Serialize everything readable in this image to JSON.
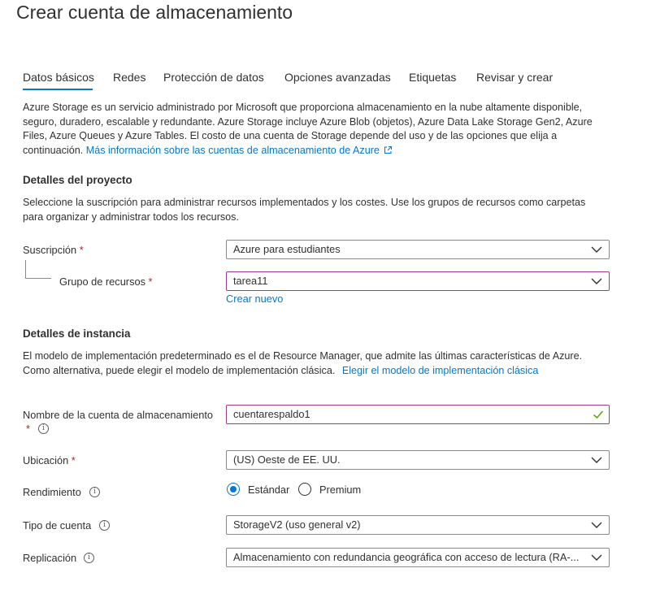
{
  "page": {
    "title": "Crear cuenta de almacenamiento"
  },
  "tabs": [
    {
      "label": "Datos básicos",
      "active": true
    },
    {
      "label": "Redes"
    },
    {
      "label": "Protección de datos"
    },
    {
      "label": "Opciones avanzadas"
    },
    {
      "label": "Etiquetas"
    },
    {
      "label": "Revisar y crear"
    }
  ],
  "intro": {
    "line1": "Azure Storage es un servicio administrado por Microsoft que proporciona almacenamiento en la nube altamente disponible,",
    "line2": "seguro, duradero, escalable y redundante. Azure Storage incluye Azure Blob (objetos), Azure Data Lake Storage Gen2, Azure",
    "line3": "Files, Azure Queues y Azure Tables. El costo de una cuenta de Storage depende del uso y de las opciones que elija a",
    "line4": "continuación.",
    "link": "Más información sobre las cuentas de almacenamiento de Azure"
  },
  "project": {
    "heading": "Detalles del proyecto",
    "desc1": "Seleccione la suscripción para administrar recursos implementados y los costes. Use los grupos de recursos como carpetas",
    "desc2": "para organizar y administrar todos los recursos.",
    "subscription_label": "Suscripción",
    "subscription_value": "Azure para estudiantes",
    "resource_group_label": "Grupo de recursos",
    "resource_group_value": "tarea11",
    "create_new": "Crear nuevo"
  },
  "instance": {
    "heading": "Detalles de instancia",
    "desc1": "El modelo de implementación predeterminado es el de Resource Manager, que admite las últimas características de Azure.",
    "desc2": "Como alternativa, puede elegir el modelo de implementación clásica.",
    "classic_link": "Elegir el modelo de implementación clásica",
    "account_name_label": "Nombre de la cuenta de almacenamiento",
    "account_name_value": "cuentarespaldo1",
    "location_label": "Ubicación",
    "location_value": "(US) Oeste de EE. UU.",
    "performance_label": "Rendimiento",
    "performance_standard": "Estándar",
    "performance_premium": "Premium",
    "performance_selected": "Estándar",
    "account_type_label": "Tipo de cuenta",
    "account_type_value": "StorageV2 (uso general v2)",
    "replication_label": "Replicación",
    "replication_value": "Almacenamiento con redundancia geográfica con acceso de lectura (RA-..."
  },
  "required_mark": "*",
  "info_glyph": "i",
  "colors": {
    "accent": "#0078d4",
    "required": "#a4262c",
    "valid_check": "#57a300",
    "focus_border": "#a4388f"
  },
  "icons": [
    "chevron-down-icon",
    "external-link-icon",
    "info-icon",
    "checkmark-icon"
  ]
}
